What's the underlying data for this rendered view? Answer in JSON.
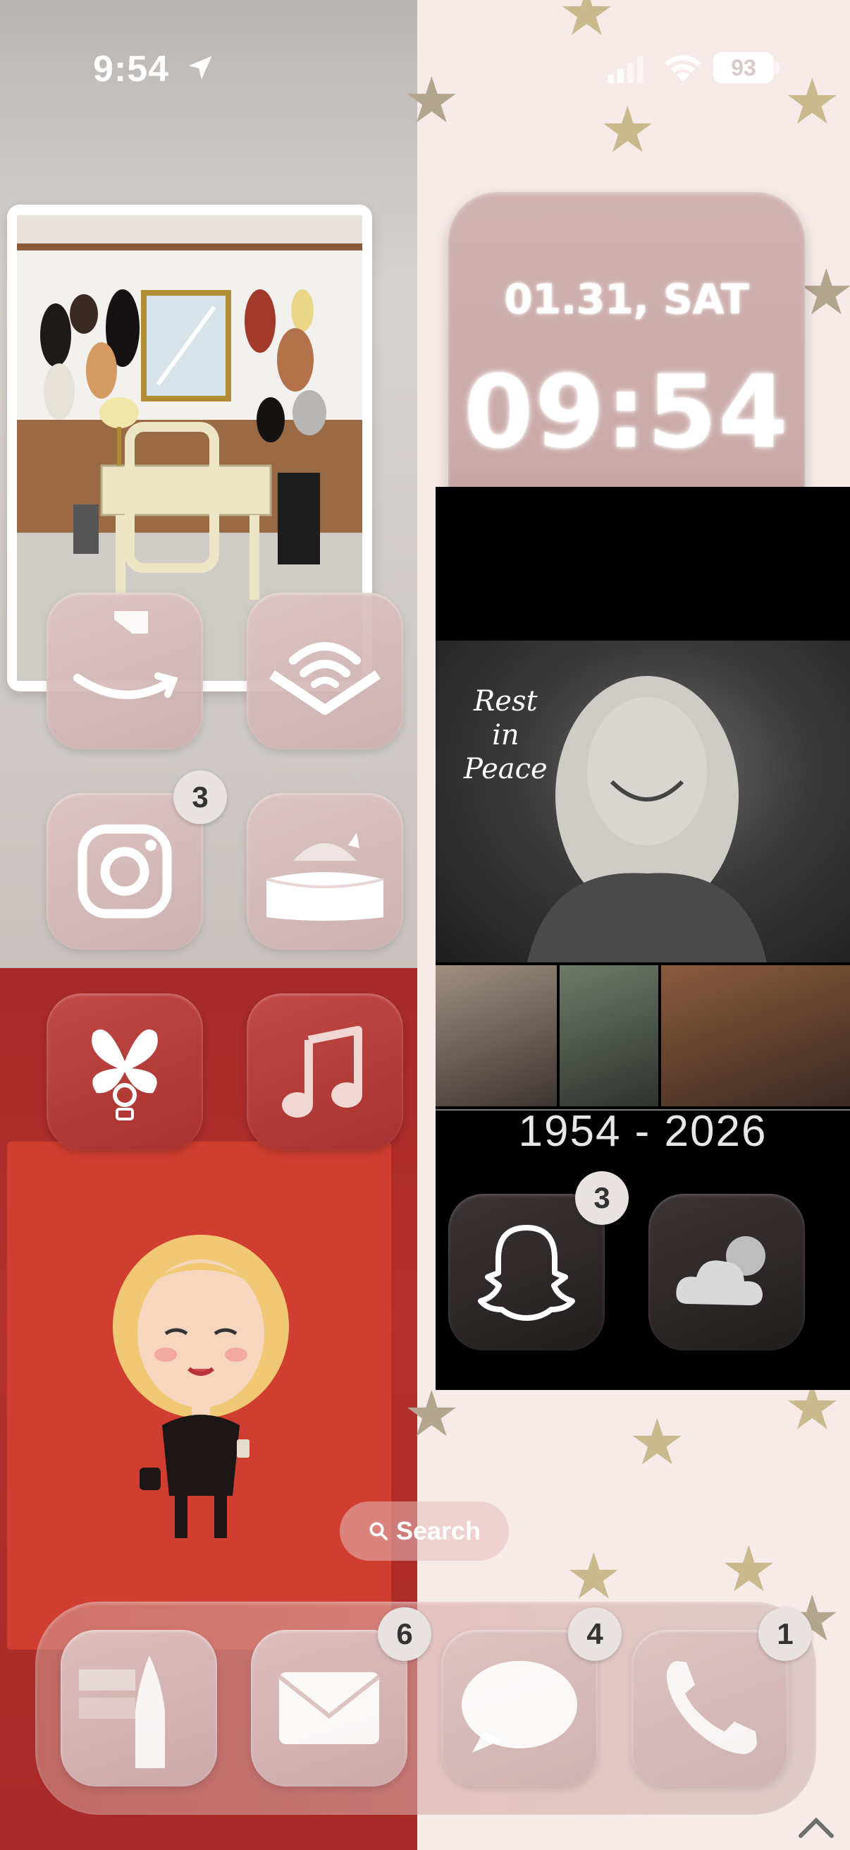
{
  "status_bar": {
    "time": "9:54",
    "battery": "93"
  },
  "apps": {
    "amazon": {
      "label": ""
    },
    "audible": {
      "label": ""
    },
    "instagram": {
      "badge": "3"
    },
    "reading": {
      "label": ""
    },
    "tipsy": {
      "label": ""
    },
    "music": {
      "label": ""
    },
    "snapchat": {
      "badge": "3"
    },
    "weather": {
      "label": ""
    }
  },
  "clock_widget": {
    "date": "01.31, SAT",
    "time": "09:54"
  },
  "memorial_widget": {
    "caption_line1": "Rest",
    "caption_line2": "in",
    "caption_line3": "Peace",
    "years": "1954 - 2026"
  },
  "search": {
    "label": "Search"
  },
  "dock": {
    "mail_badge": "6",
    "messages_badge": "4",
    "phone_badge": "1"
  },
  "colors": {
    "icon_tint": "#d4b6b5",
    "left_red": "#a82a28",
    "panel_red": "#cf3e31",
    "right_bg": "#f6ebe9",
    "star": "#c9b98c"
  },
  "icons": [
    "location-arrow-icon",
    "signal-icon",
    "wifi-icon",
    "battery-icon",
    "search-icon",
    "amazon-smile-icon",
    "audible-icon",
    "instagram-camera-icon",
    "reading-bowl-icon",
    "butterfly-icon",
    "music-note-icon",
    "snapchat-ghost-icon",
    "cloud-icon",
    "notes-pen-icon",
    "mail-envelope-icon",
    "speech-bubble-icon",
    "phone-handset-icon"
  ]
}
